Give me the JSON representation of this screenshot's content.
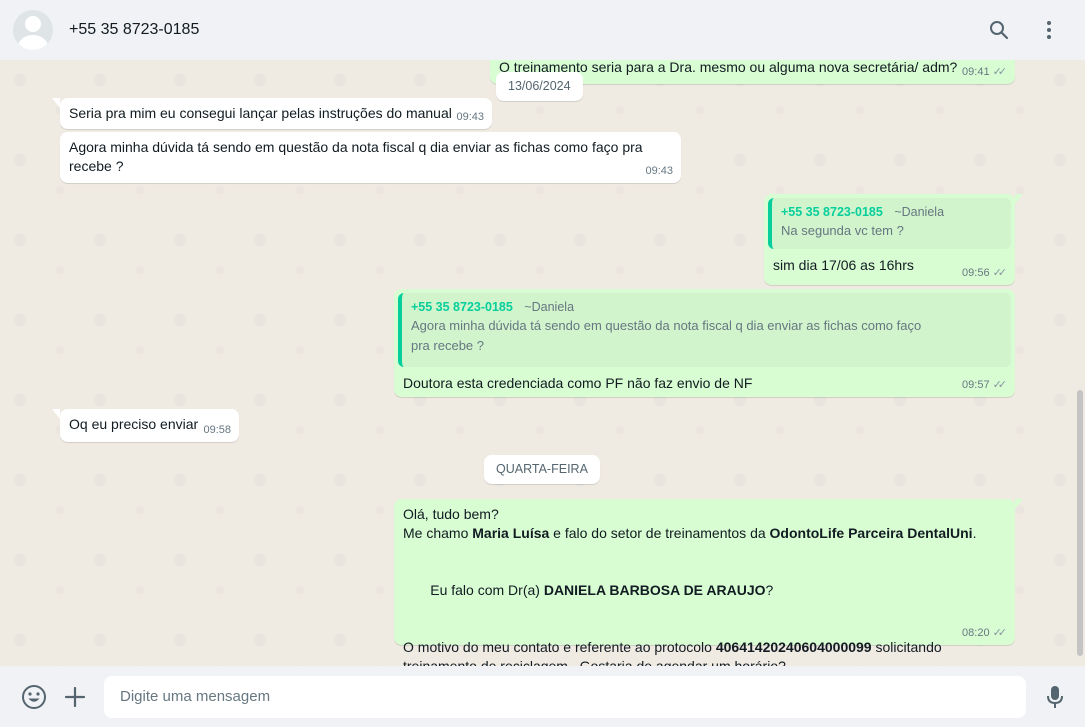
{
  "header": {
    "contact_name": "+55 35 8723-0185"
  },
  "date_pills": {
    "d1": "13/06/2024",
    "d2": "QUARTA-FEIRA"
  },
  "messages": {
    "m0": {
      "text": "O treinamento seria para a Dra. mesmo ou alguma nova secretária/ adm?",
      "time": "09:41"
    },
    "m1": {
      "text": "Seria pra mim eu consegui lançar pelas instruções do manual",
      "time": "09:43"
    },
    "m2": {
      "line1": "Agora minha dúvida tá sendo em questão da nota fiscal q dia enviar as fichas como faço pra",
      "line2": "recebe ?",
      "time": "09:43"
    },
    "m3": {
      "quote_number": "+55 35 8723-0185",
      "quote_alias": "~Daniela",
      "quote_text": "Na segunda vc tem ?",
      "text": "sim dia 17/06 as 16hrs",
      "time": "09:56"
    },
    "m4": {
      "quote_number": "+55 35 8723-0185",
      "quote_alias": "~Daniela",
      "quote_line1": "Agora minha dúvida tá sendo em questão da nota fiscal q dia enviar as fichas como faço",
      "quote_line2": "pra recebe ?",
      "text": "Doutora esta credenciada como PF não faz envio de NF",
      "time": "09:57"
    },
    "m5": {
      "text": "Oq eu preciso enviar",
      "time": "09:58"
    },
    "m6": {
      "l1": "Olá, tudo bem?",
      "l2_a": "Me chamo ",
      "l2_b": "Maria Luísa",
      "l2_c": " e falo do setor de treinamentos  da ",
      "l2_d": "OdontoLife Parceira DentalUni",
      "l2_e": ".",
      "l3_a": " Eu falo com Dr(a) ",
      "l3_b": "DANIELA BARBOSA DE ARAUJO",
      "l3_c": "?",
      "l4_a": "O motivo do meu contato e referente ao protocolo ",
      "l4_b": "40641420240604000099",
      "l4_c": " solicitando",
      "l5": "treinamento de reciclagem . Gostaria de agendar um horário?",
      "time": "08:20"
    }
  },
  "composer": {
    "placeholder": "Digite uma mensagem"
  },
  "colors": {
    "incoming": "#ffffff",
    "outgoing": "#d9fdd3",
    "quote_accent": "#06cf9c",
    "chat_bg": "#efeae2",
    "panel_bg": "#f0f2f5"
  },
  "icons": [
    "avatar-placeholder",
    "search-icon",
    "menu-dots-icon",
    "emoji-icon",
    "plus-icon",
    "mic-icon",
    "double-check-icon"
  ]
}
